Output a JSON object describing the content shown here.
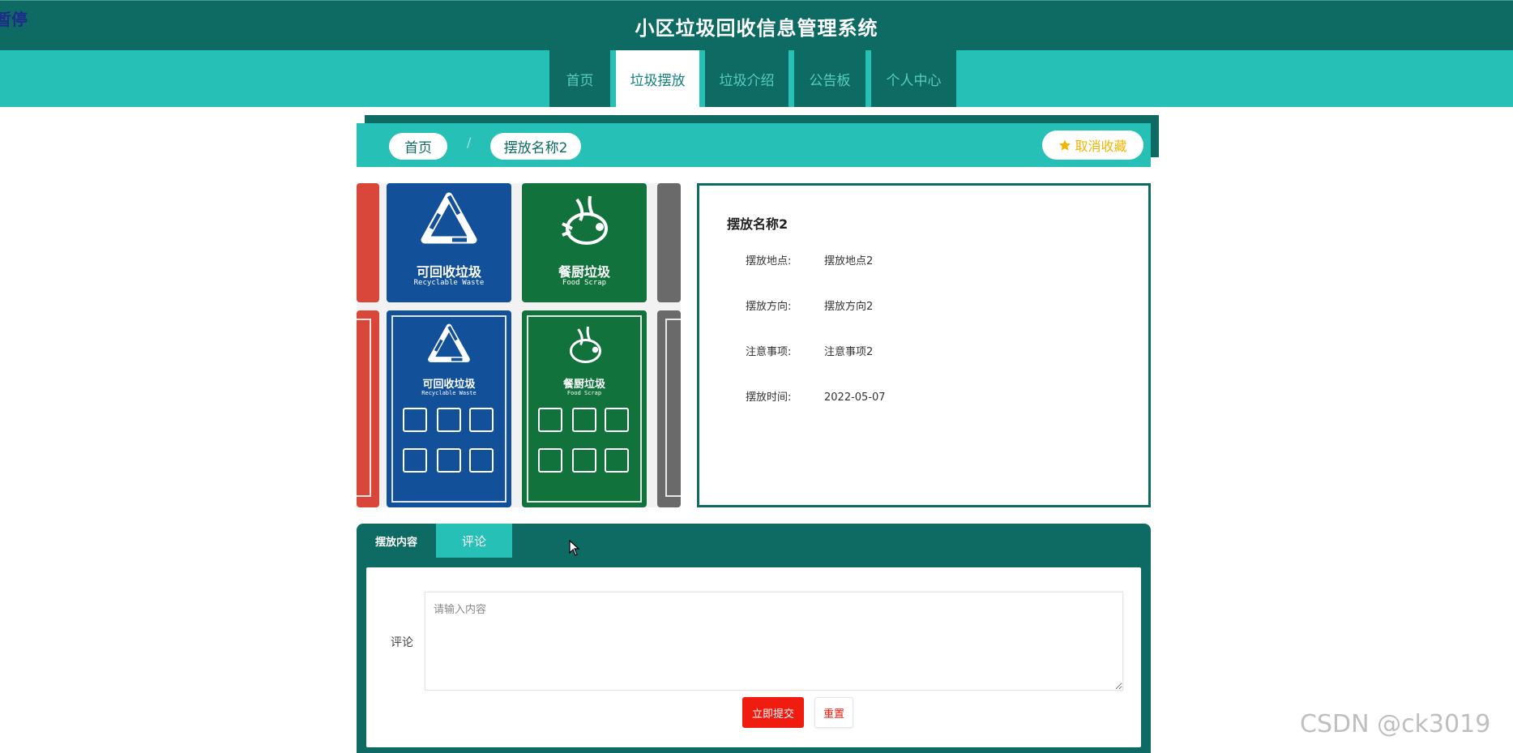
{
  "overlay": {
    "pause_label": "暂停"
  },
  "header": {
    "title": "小区垃圾回收信息管理系统"
  },
  "nav": {
    "items": [
      {
        "label": "首页",
        "active": false
      },
      {
        "label": "垃圾摆放",
        "active": true
      },
      {
        "label": "垃圾介绍",
        "active": false
      },
      {
        "label": "公告板",
        "active": false
      },
      {
        "label": "个人中心",
        "active": false
      }
    ]
  },
  "breadcrumb": {
    "home": "首页",
    "separator": "/",
    "current": "摆放名称2",
    "favorite_label": "取消收藏"
  },
  "gallery": {
    "signs": [
      {
        "cn": "可回收垃圾",
        "en": "Recyclable Waste",
        "color": "#12509a"
      },
      {
        "cn": "餐厨垃圾",
        "en": "Food Scrap",
        "color": "#11733b"
      }
    ],
    "side_colors": {
      "left": "#d9473a",
      "right": "#6a6a6a"
    }
  },
  "details": {
    "title": "摆放名称2",
    "fields": [
      {
        "label": "摆放地点:",
        "value": "摆放地点2"
      },
      {
        "label": "摆放方向:",
        "value": "摆放方向2"
      },
      {
        "label": "注意事项:",
        "value": "注意事项2"
      },
      {
        "label": "摆放时间:",
        "value": "2022-05-07"
      }
    ]
  },
  "tabs": [
    {
      "label": "摆放内容",
      "active": false
    },
    {
      "label": "评论",
      "active": true
    }
  ],
  "comment": {
    "label": "评论",
    "placeholder": "请输入内容",
    "value": "",
    "submit_label": "立即提交",
    "reset_label": "重置"
  },
  "watermark": "CSDN @ck3019",
  "colors": {
    "primary_dark": "#0e6b63",
    "primary": "#26c0b6",
    "danger": "#f11c10",
    "star": "#f2b400"
  }
}
